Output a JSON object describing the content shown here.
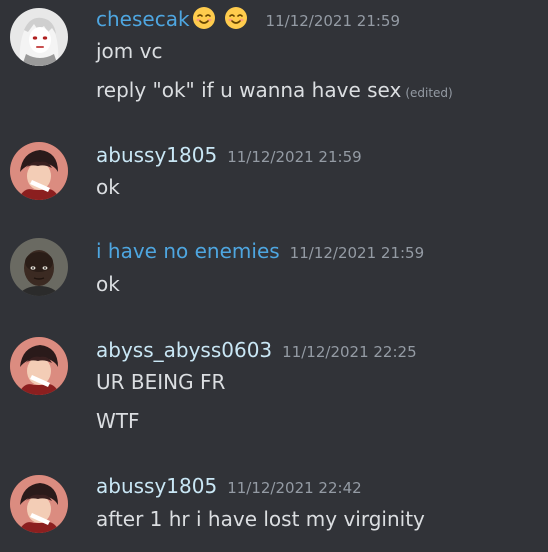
{
  "colors": {
    "background": "#313338",
    "text": "#dbdee1",
    "muted": "#949ba4",
    "username_blue": "#4ea6e0",
    "username_light": "#c9e7f5"
  },
  "messages": [
    {
      "username": "chesecak",
      "name_color": "#4ea6e0",
      "emojis": [
        "smiling-face-emoji",
        "smiling-face-emoji"
      ],
      "timestamp": "11/12/2021 21:59",
      "lines": [
        {
          "text": "jom vc"
        },
        {
          "text": "reply \"ok\" if u wanna have sex",
          "edited": "(edited)"
        }
      ]
    },
    {
      "username": "abussy1805",
      "name_color": "#c9e7f5",
      "timestamp": "11/12/2021 21:59",
      "lines": [
        {
          "text": "ok"
        }
      ]
    },
    {
      "username": "i have no enemies",
      "name_color": "#4ea6e0",
      "timestamp": "11/12/2021 21:59",
      "lines": [
        {
          "text": "ok"
        }
      ]
    },
    {
      "username": "abyss_abyss0603",
      "name_color": "#c9e7f5",
      "timestamp": "11/12/2021 22:25",
      "lines": [
        {
          "text": "UR BEING FR"
        },
        {
          "text": "WTF"
        }
      ]
    },
    {
      "username": "abussy1805",
      "name_color": "#c9e7f5",
      "timestamp": "11/12/2021 22:42",
      "lines": [
        {
          "text": "after 1 hr i have lost my virginity"
        }
      ]
    }
  ]
}
